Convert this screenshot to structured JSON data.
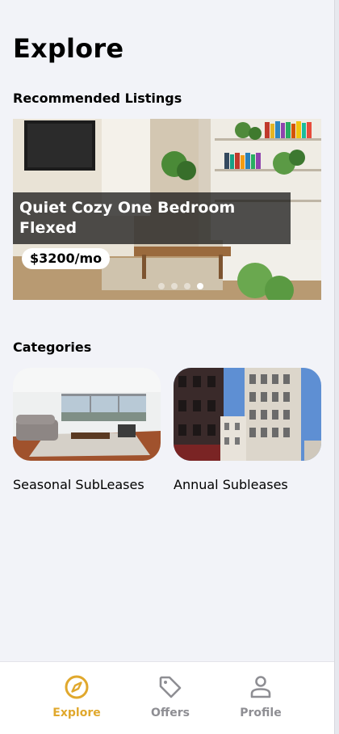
{
  "header": {
    "title": "Explore"
  },
  "recommended": {
    "section_title": "Recommended Listings",
    "listing": {
      "title": "Quiet Cozy One Bedroom Flexed",
      "price": "$3200/mo",
      "image": "living-room-photo"
    },
    "carousel": {
      "page_count": 4,
      "active_index": 3
    }
  },
  "categories": {
    "section_title": "Categories",
    "items": [
      {
        "label": "Seasonal SubLeases",
        "image": "living-room-photo"
      },
      {
        "label": "Annual Subleases",
        "image": "city-buildings-photo"
      }
    ]
  },
  "tab_bar": {
    "active_color": "#e0a82d",
    "inactive_color": "#8e8e93",
    "tabs": [
      {
        "label": "Explore",
        "icon": "compass-icon",
        "active": true
      },
      {
        "label": "Offers",
        "icon": "tag-icon",
        "active": false
      },
      {
        "label": "Profile",
        "icon": "person-icon",
        "active": false
      }
    ]
  }
}
